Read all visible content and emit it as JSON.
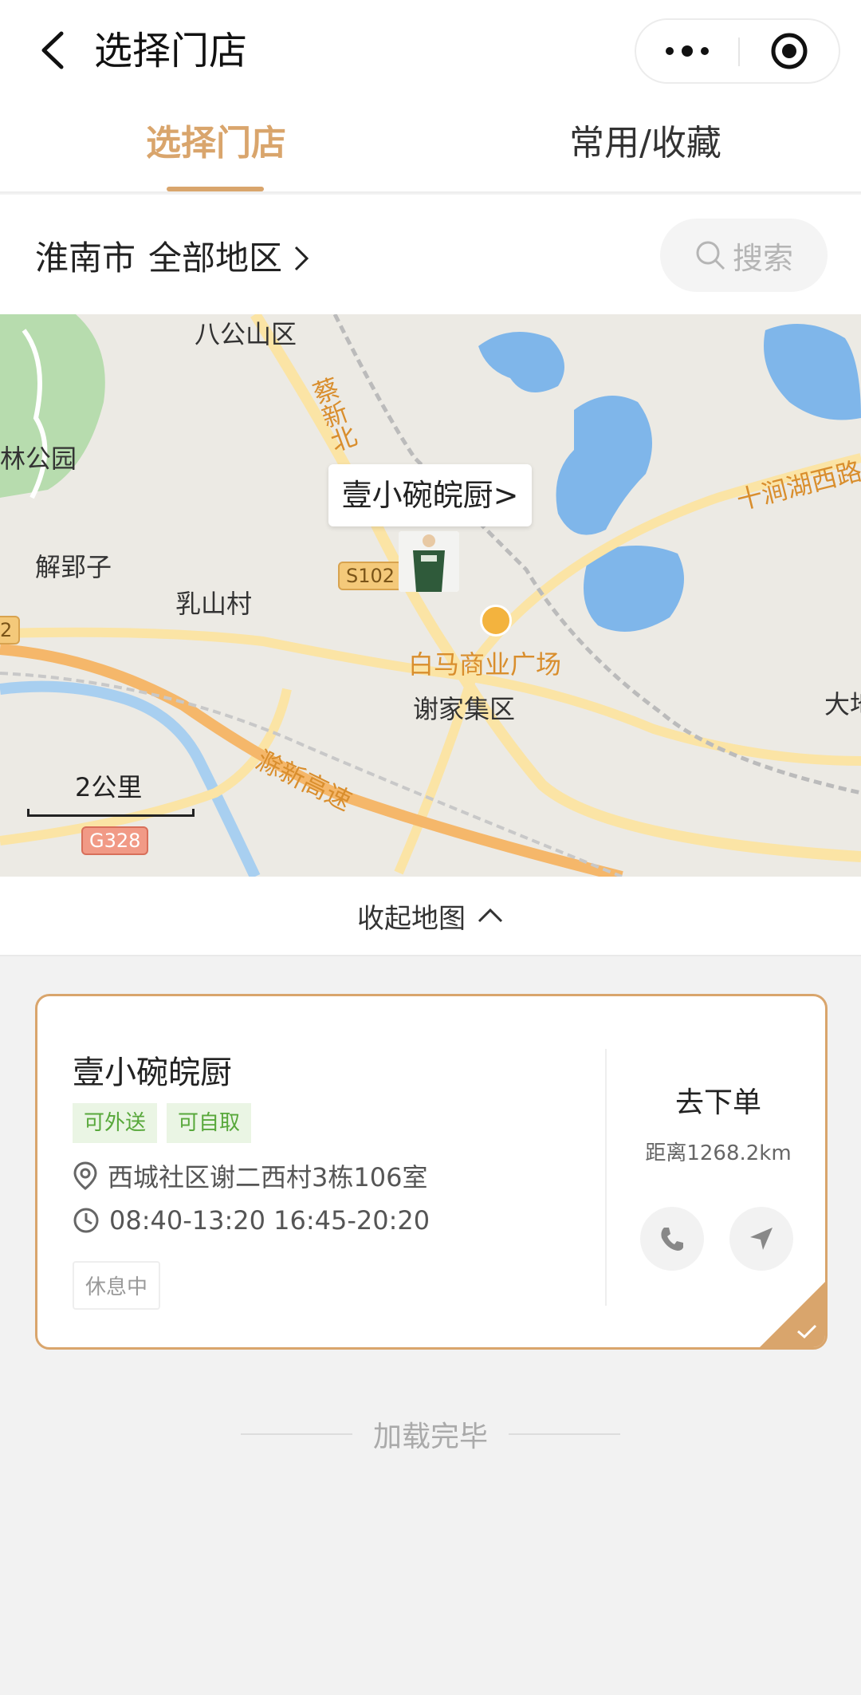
{
  "header": {
    "title": "选择门店"
  },
  "tabs": [
    {
      "label": "选择门店",
      "active": true
    },
    {
      "label": "常用/收藏",
      "active": false
    }
  ],
  "location": {
    "city": "淮南市",
    "area": "全部地区"
  },
  "search": {
    "label": "搜索"
  },
  "map": {
    "callout": "壹小碗皖厨>",
    "labels": {
      "district1": "八公山区",
      "road_north": "蔡新北",
      "park": "林公园",
      "jieyingzi": "解郢子",
      "rushan": "乳山村",
      "baima": "白马商业广场",
      "xiejiaji": "谢家集区",
      "shijian": "十涧湖西路",
      "chuxin": "滁新高速",
      "dadi": "大地"
    },
    "badges": {
      "s102": "S102",
      "g328": "G328",
      "edge": "2"
    },
    "scale_label": "2公里"
  },
  "collapse_map_label": "收起地图",
  "store": {
    "name": "壹小碗皖厨",
    "tags": [
      "可外送",
      "可自取"
    ],
    "address": "西城社区谢二西村3栋106室",
    "hours": "08:40-13:20 16:45-20:20",
    "status": "休息中",
    "order_label": "去下单",
    "distance": "距离1268.2km"
  },
  "footer": {
    "loaded_label": "加载完毕"
  },
  "colors": {
    "accent": "#d9a56c",
    "tag_green": "#58a83b",
    "tag_green_bg": "#eaf5e4"
  }
}
